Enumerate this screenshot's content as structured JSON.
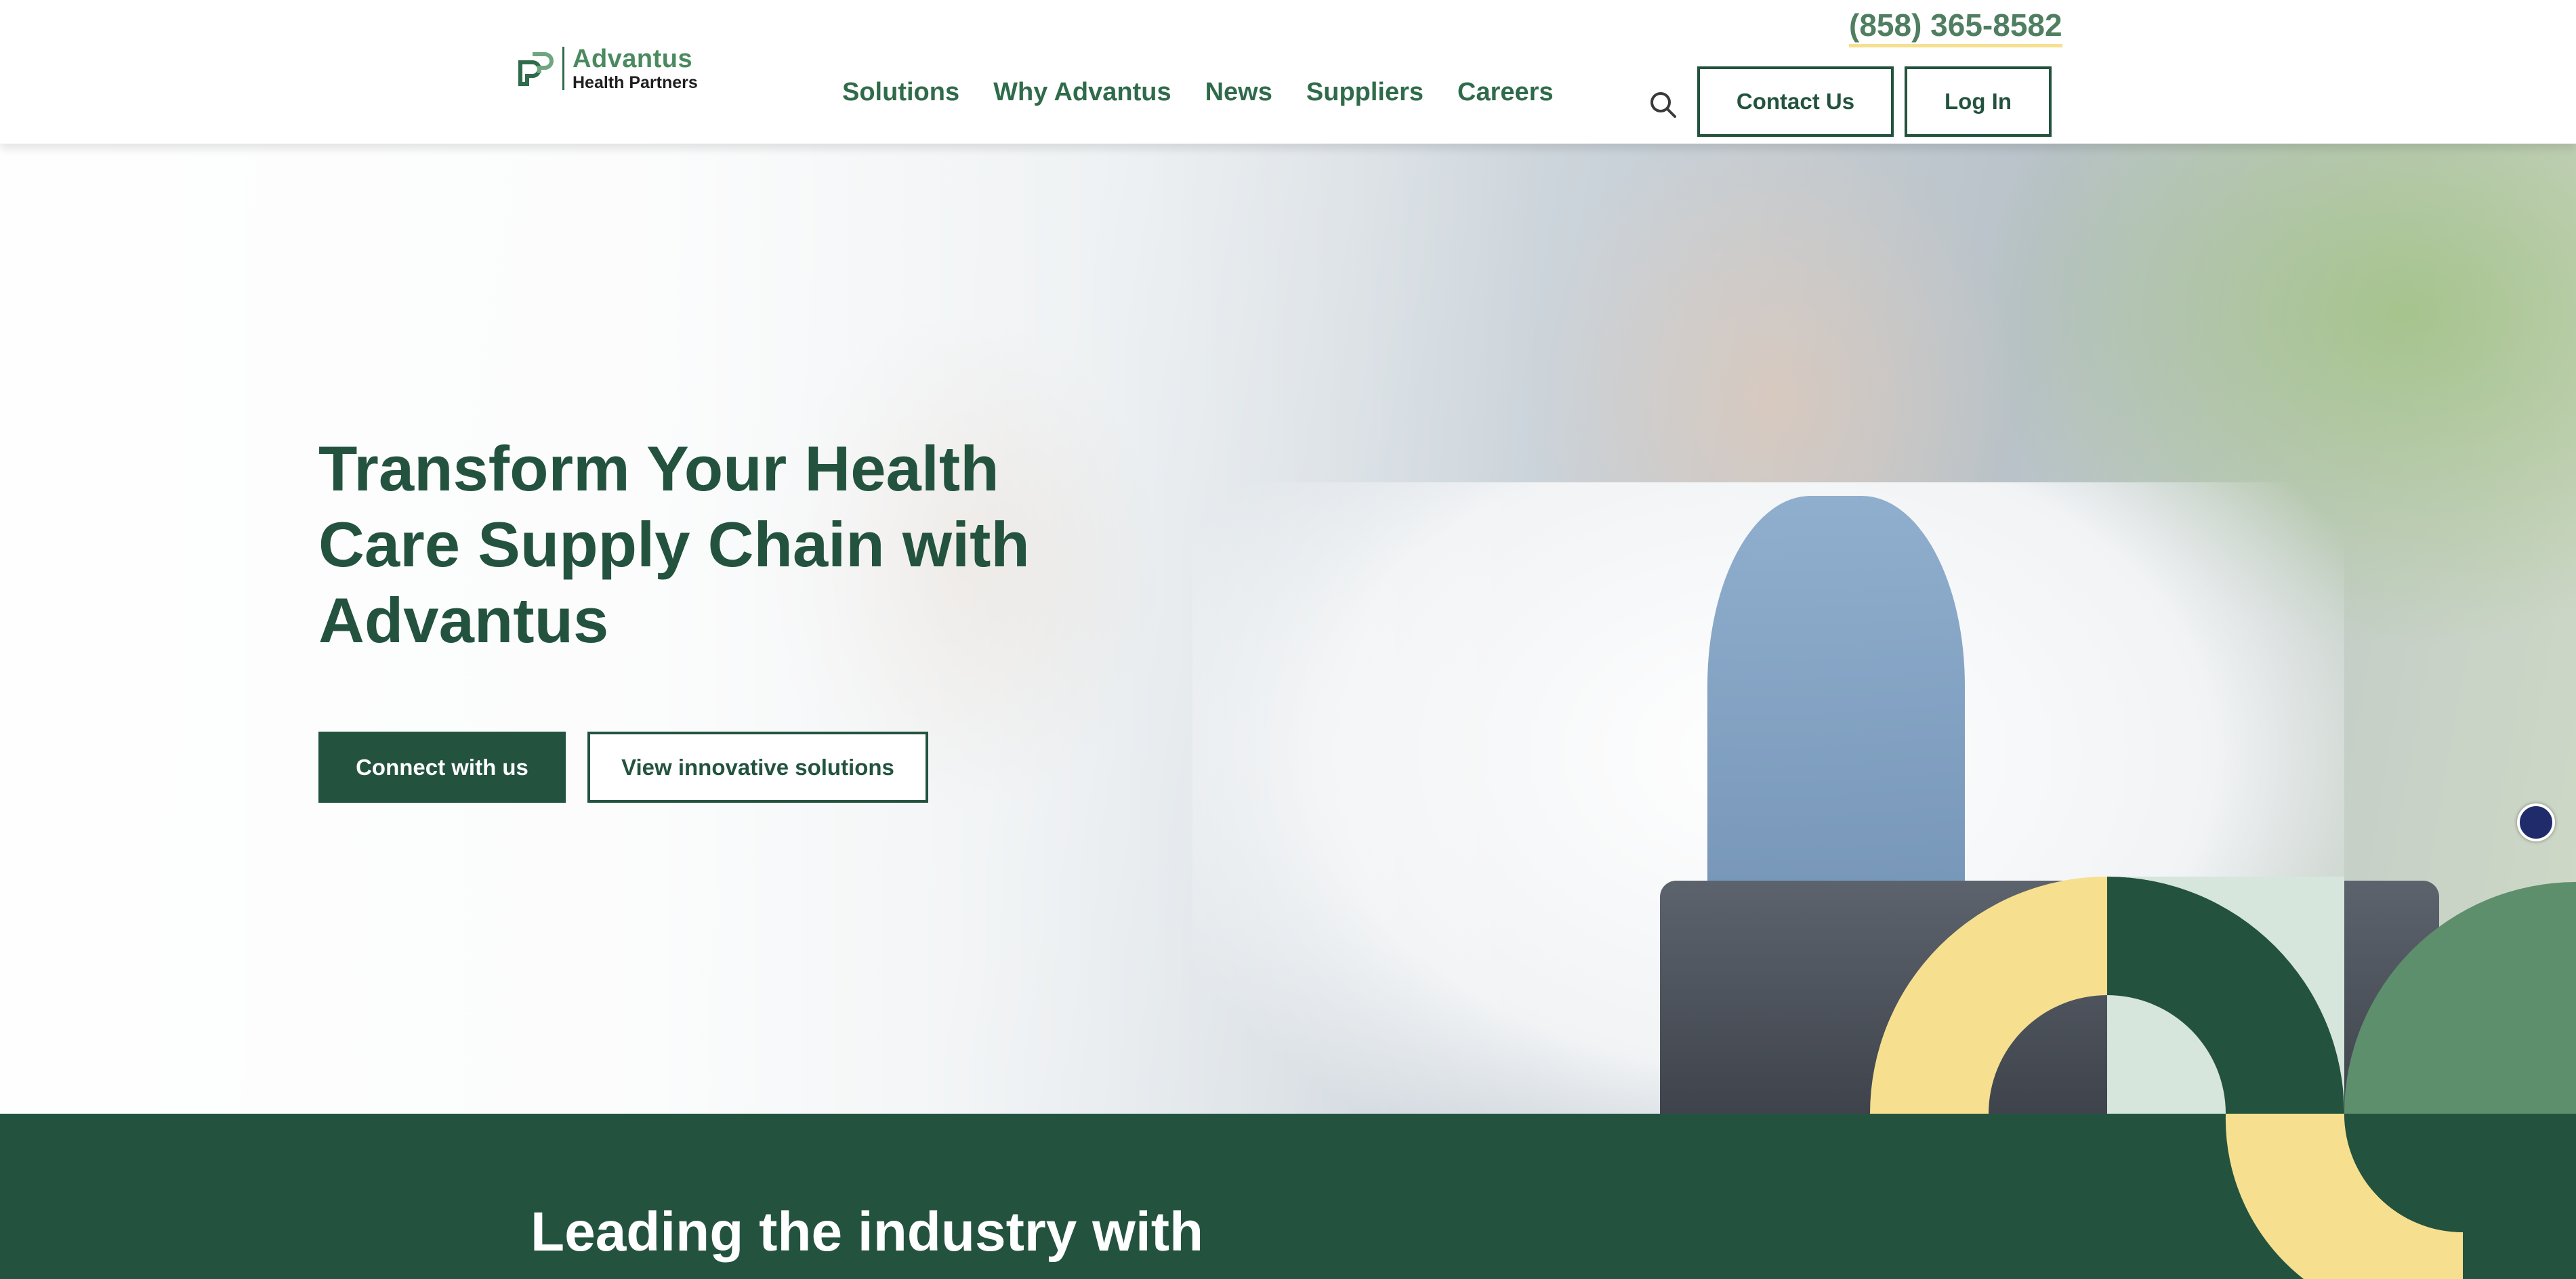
{
  "brand": {
    "name": "Advantus",
    "subname": "Health Partners",
    "primary_color": "#23533f",
    "accent_color": "#4f7f60",
    "highlight_color": "#f6e08f",
    "mint_color": "#d6e6dc"
  },
  "header": {
    "phone": "(858) 365-8582",
    "nav": [
      {
        "label": "Solutions"
      },
      {
        "label": "Why Advantus"
      },
      {
        "label": "News"
      },
      {
        "label": "Suppliers"
      },
      {
        "label": "Careers"
      }
    ],
    "search_icon": "search-icon",
    "contact_label": "Contact Us",
    "login_label": "Log In"
  },
  "hero": {
    "title": "Transform Your Health Care Supply Chain with Advantus",
    "primary_cta": "Connect with us",
    "secondary_cta": "View innovative solutions"
  },
  "section2": {
    "title": "Leading the industry with"
  }
}
